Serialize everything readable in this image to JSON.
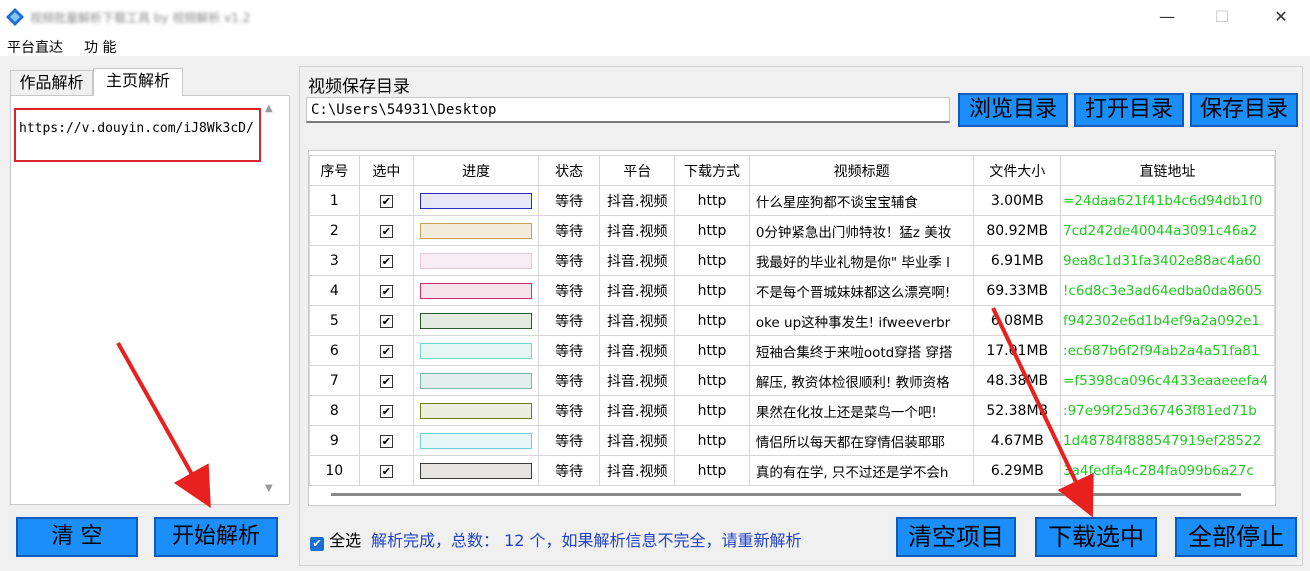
{
  "window": {
    "title": "视频批量解析下载工具 by 视频解析 v1.2",
    "minimize": "—",
    "maximize": "☐",
    "close": "✕"
  },
  "menu": [
    "平台直达",
    "功 能"
  ],
  "left": {
    "tabs": [
      "作品解析",
      "主页解析"
    ],
    "url_value": "https://v.douyin.com/iJ8Wk3cD/",
    "clear_label": "清  空",
    "start_label": "开始解析"
  },
  "right": {
    "dir_label": "视频保存目录",
    "dir_value": "C:\\Users\\54931\\Desktop",
    "browse_label": "浏览目录",
    "open_label": "打开目录",
    "save_label": "保存目录"
  },
  "table": {
    "headers": [
      "序号",
      "选中",
      "进度",
      "状态",
      "平台",
      "下载方式",
      "视频标题",
      "文件大小",
      "直链地址"
    ],
    "rows": [
      {
        "num": "1",
        "checked": "✔",
        "status": "等待",
        "platform": "抖音.视频",
        "method": "http",
        "title": "什么星座狗都不谈宝宝辅食",
        "size": "3.00MB",
        "url": "=24daa621f41b4c6d94db1f0",
        "bar": "#2b2dbf",
        "fill": "#e7e8f7"
      },
      {
        "num": "2",
        "checked": "✔",
        "status": "等待",
        "platform": "抖音.视频",
        "method": "http",
        "title": "0分钟紧急出门帅特妆！猛z 美妆",
        "size": "80.92MB",
        "url": "7cd242de40044a3091c46a2",
        "bar": "#c8a25a",
        "fill": "#f3ecdc"
      },
      {
        "num": "3",
        "checked": "✔",
        "status": "等待",
        "platform": "抖音.视频",
        "method": "http",
        "title": "我最好的毕业礼物是你\" 毕业季 l",
        "size": "6.91MB",
        "url": "9ea8c1d31fa3402e88ac4a60",
        "bar": "#e6c8d6",
        "fill": "#f6ecf2"
      },
      {
        "num": "4",
        "checked": "✔",
        "status": "等待",
        "platform": "抖音.视频",
        "method": "http",
        "title": "不是每个晋城妹妹都这么漂亮啊!",
        "size": "69.33MB",
        "url": "!c6d8c3e3ad64edba0da8605",
        "bar": "#cc2f6b",
        "fill": "#f7e3ea"
      },
      {
        "num": "5",
        "checked": "✔",
        "status": "等待",
        "platform": "抖音.视频",
        "method": "http",
        "title": "oke up这种事发生! ifweeverbr",
        "size": "6.08MB",
        "url": "f942302e6d1b4ef9a2a092e1",
        "bar": "#2e5b2e",
        "fill": "#e3ebe1"
      },
      {
        "num": "6",
        "checked": "✔",
        "status": "等待",
        "platform": "抖音.视频",
        "method": "http",
        "title": "短袖合集终于来啦ootd穿搭 穿搭",
        "size": "17.01MB",
        "url": ":ec687b6f2f94ab2a4a51fa81",
        "bar": "#6fd7c8",
        "fill": "#e4f5f2"
      },
      {
        "num": "7",
        "checked": "✔",
        "status": "等待",
        "platform": "抖音.视频",
        "method": "http",
        "title": "解压, 教资体检很顺利! 教师资格",
        "size": "48.38MB",
        "url": "=f5398ca096c4433eaaeeefa4",
        "bar": "#7bb7a9",
        "fill": "#e3efec"
      },
      {
        "num": "8",
        "checked": "✔",
        "status": "等待",
        "platform": "抖音.视频",
        "method": "http",
        "title": "果然在化妆上还是菜鸟一个吧!",
        "size": "52.38MB",
        "url": ":97e99f25d367463f81ed71b",
        "bar": "#6b7b1d",
        "fill": "#eceee0"
      },
      {
        "num": "9",
        "checked": "✔",
        "status": "等待",
        "platform": "抖音.视频",
        "method": "http",
        "title": "情侣所以每天都在穿情侣装耶耶",
        "size": "4.67MB",
        "url": "1d48784f888547919ef28522",
        "bar": "#6fcfd2",
        "fill": "#e6f5f6"
      },
      {
        "num": "10",
        "checked": "✔",
        "status": "等待",
        "platform": "抖音.视频",
        "method": "http",
        "title": "真的有在学, 只不过还是学不会h",
        "size": "6.29MB",
        "url": "3a4fedfa4c284fa099b6a27c",
        "bar": "#3a3a3a",
        "fill": "#e6e4e2"
      }
    ]
  },
  "bottom": {
    "select_all_check": "✔",
    "select_all_label": "全选",
    "status": "解析完成，总数： 12 个，如果解析信息不完全，请重新解析",
    "clear_items_label": "清空项目",
    "download_label": "下载选中",
    "stop_label": "全部停止"
  }
}
